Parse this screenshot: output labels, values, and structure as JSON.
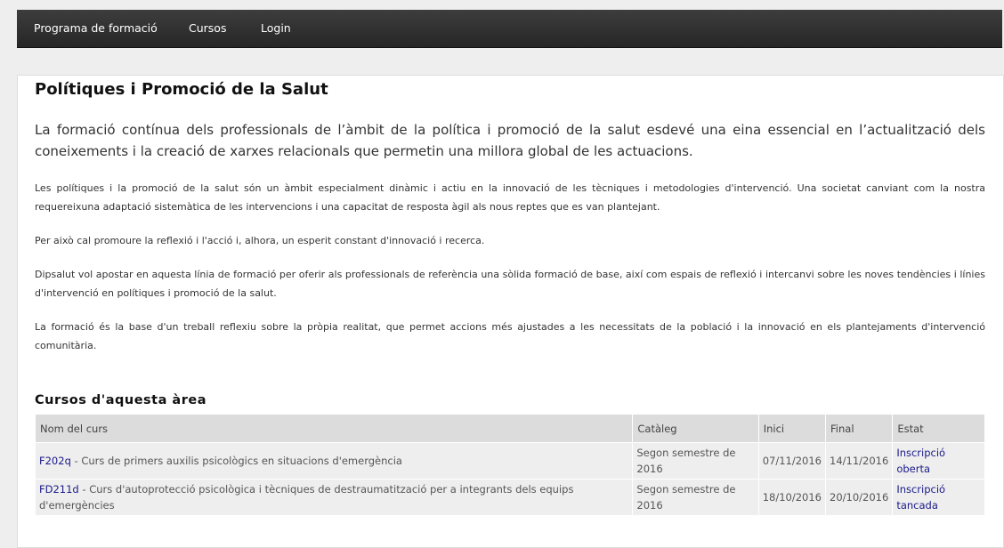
{
  "nav": {
    "items": [
      "Programa de formació",
      "Cursos",
      "Login"
    ]
  },
  "page": {
    "title": "Polítiques i Promoció de la Salut",
    "lead": "La formació contínua dels professionals de l’àmbit de la política i promoció de la salut esdevé una eina essencial en l’actualització dels coneixements i la creació de xarxes relacionals que permetin una millora global de les actuacions.",
    "paragraphs": [
      "Les polítiques i la promoció de la salut són un àmbit especialment dinàmic i actiu en la innovació de les tècniques i metodologies d'intervenció. Una societat canviant com la nostra requereixuna adaptació sistemàtica de les intervencions i una capacitat de resposta àgil als nous reptes que es van plantejant.",
      "Per això cal promoure la reflexió i l'acció i, alhora, un esperit constant d'innovació i recerca.",
      "Dipsalut vol apostar en aquesta línia de formació per oferir als professionals de referència una sòlida formació de base, així com espais de reflexió i intercanvi sobre les noves tendències i línies d'intervenció en polítiques i promoció de la salut.",
      "La formació és la base d'un treball reflexiu sobre la pròpia realitat, que permet accions més ajustades a les necessitats de la població i la innovació en els plantejaments d'intervenció comunitària."
    ]
  },
  "courses": {
    "heading": "Cursos d'aquesta àrea",
    "columns": [
      "Nom del curs",
      "Catàleg",
      "Inici",
      "Final",
      "Estat"
    ],
    "rows": [
      {
        "code": "F202q",
        "name": " - Curs de primers auxilis psicològics en situacions d'emergència",
        "catalog": "Segon semestre de 2016",
        "start": "07/11/2016",
        "end": "14/11/2016",
        "status": "Inscripció oberta"
      },
      {
        "code": "FD211d",
        "name": " - Curs d'autoprotecció psicològica i tècniques de destraumatització per a integrants dels equips d'emergències",
        "catalog": "Segon semestre de 2016",
        "start": "18/10/2016",
        "end": "20/10/2016",
        "status": "Inscripció tancada"
      }
    ]
  }
}
